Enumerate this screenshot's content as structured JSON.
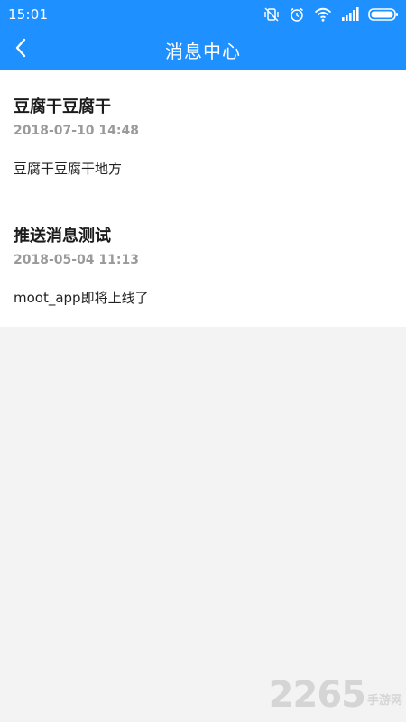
{
  "status_bar": {
    "time": "15:01",
    "icons": [
      "mute-vibrate-icon",
      "alarm-icon",
      "wifi-icon",
      "signal-icon",
      "battery-icon"
    ]
  },
  "app_bar": {
    "title": "消息中心",
    "back_icon": "chevron-left-icon"
  },
  "messages": [
    {
      "title": "豆腐干豆腐干",
      "time": "2018-07-10 14:48",
      "body": "豆腐干豆腐干地方"
    },
    {
      "title": "推送消息测试",
      "time": "2018-05-04 11:13",
      "body": "moot_app即将上线了"
    }
  ],
  "watermark": {
    "digits": "2265",
    "text": "手游网"
  },
  "colors": {
    "primary": "#1e90ff",
    "background": "#f3f3f3",
    "title_text": "#1b1b1b",
    "time_text": "#9a9a9a"
  }
}
